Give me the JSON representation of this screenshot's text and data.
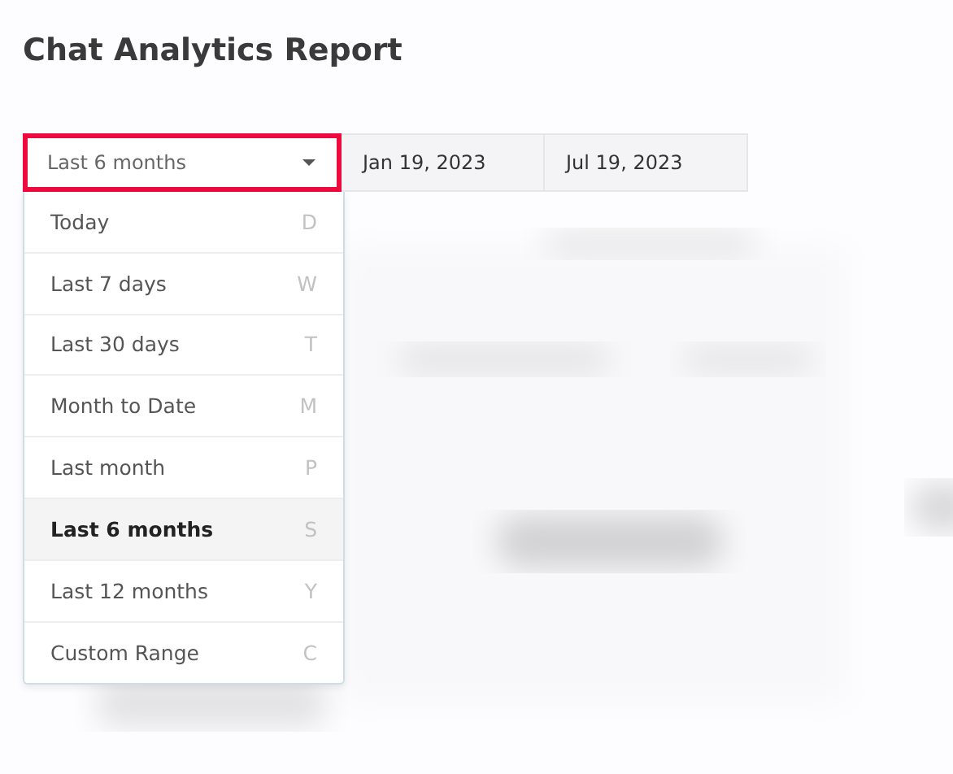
{
  "title": "Chat Analytics Report",
  "range_dropdown": {
    "value": "Last 6 months",
    "highlighted": true
  },
  "date_fields": [
    {
      "value": "Jan 19, 2023"
    },
    {
      "value": "Jul 19, 2023"
    }
  ],
  "range_menu": [
    {
      "label": "Today",
      "shortcut": "D",
      "selected": false
    },
    {
      "label": "Last 7 days",
      "shortcut": "W",
      "selected": false
    },
    {
      "label": "Last 30 days",
      "shortcut": "T",
      "selected": false
    },
    {
      "label": "Month to Date",
      "shortcut": "M",
      "selected": false
    },
    {
      "label": "Last month",
      "shortcut": "P",
      "selected": false
    },
    {
      "label": "Last 6 months",
      "shortcut": "S",
      "selected": true
    },
    {
      "label": "Last 12 months",
      "shortcut": "Y",
      "selected": false
    },
    {
      "label": "Custom Range",
      "shortcut": "C",
      "selected": false
    }
  ]
}
